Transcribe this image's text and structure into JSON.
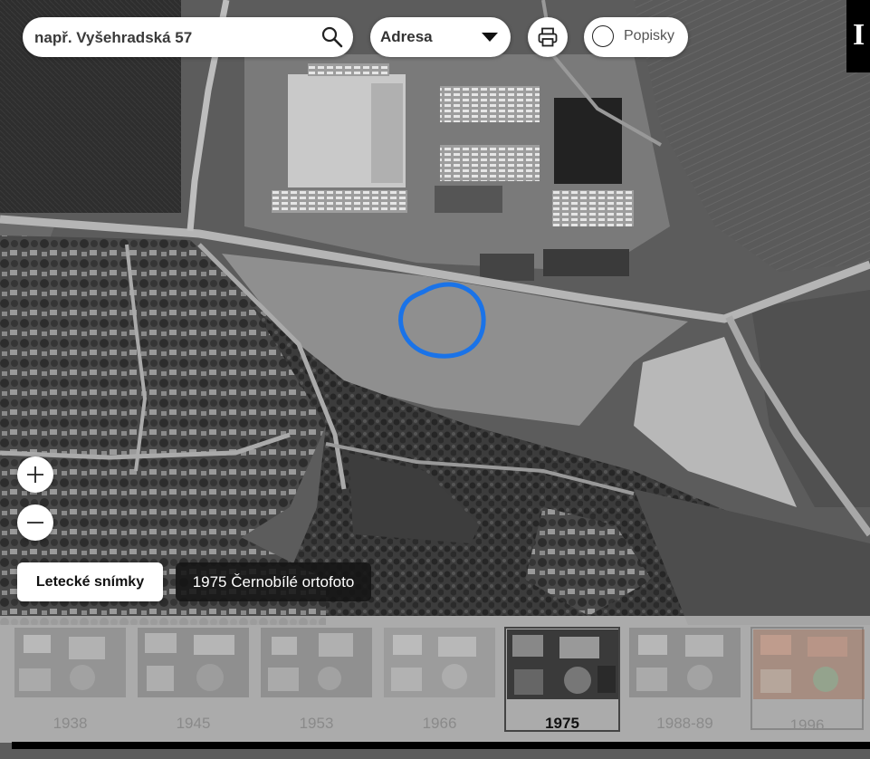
{
  "search": {
    "placeholder": "např. Vyšehradská 57"
  },
  "address_select": {
    "selected": "Adresa"
  },
  "labels_toggle": {
    "label": "Popisky"
  },
  "info": {
    "glyph": "I"
  },
  "layer": {
    "button_label": "Letecké snímky",
    "current_layer": "1975 Černobílé ortofoto"
  },
  "timeline": {
    "years": [
      {
        "label": "1938",
        "state": "inactive"
      },
      {
        "label": "1945",
        "state": "inactive"
      },
      {
        "label": "1953",
        "state": "inactive"
      },
      {
        "label": "1966",
        "state": "inactive"
      },
      {
        "label": "1975",
        "state": "active"
      },
      {
        "label": "1988-89",
        "state": "inactive"
      },
      {
        "label": "1996",
        "state": "inactive"
      }
    ]
  },
  "colors": {
    "highlight": "#1a73e8",
    "active_border": "#444444"
  },
  "icons": [
    "search-icon",
    "chevron-down-icon",
    "printer-icon",
    "plus-icon",
    "minus-icon"
  ]
}
